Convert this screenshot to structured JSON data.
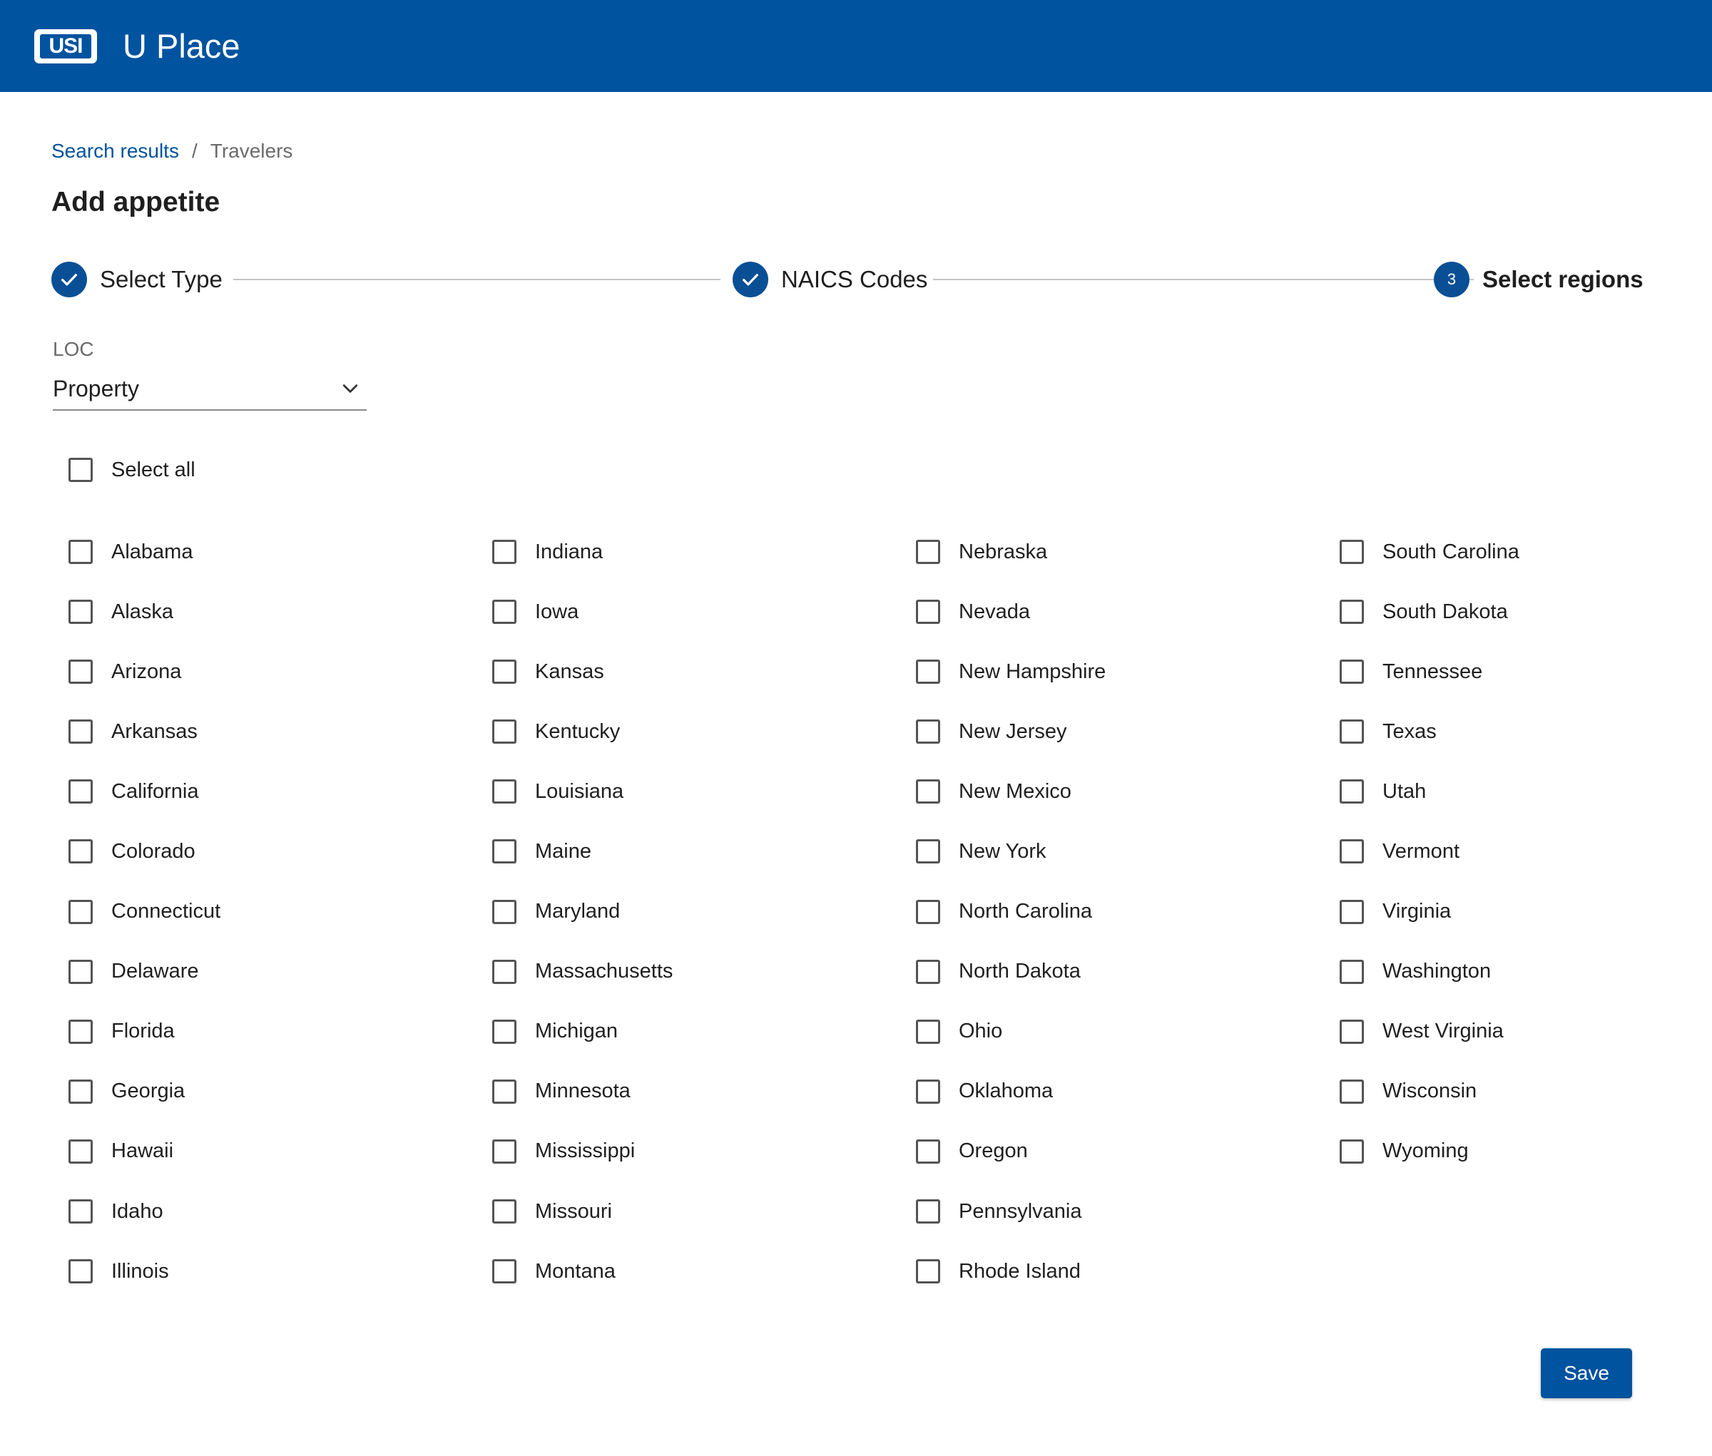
{
  "header": {
    "logo_text": "USI",
    "app_title": "U Place",
    "brand_color": "#00539f"
  },
  "breadcrumb": {
    "link": "Search results",
    "separator": "/",
    "current": "Travelers"
  },
  "page_title": "Add appetite",
  "stepper": {
    "steps": [
      {
        "label": "Select Type",
        "status": "complete",
        "icon": "check-icon"
      },
      {
        "label": "NAICS Codes",
        "status": "complete",
        "icon": "check-icon"
      },
      {
        "label": "Select regions",
        "status": "active",
        "number": "3"
      }
    ]
  },
  "loc": {
    "label": "LOC",
    "value": "Property",
    "icon": "chevron-down-icon"
  },
  "select_all": {
    "label": "Select all",
    "checked": false
  },
  "states": [
    "Alabama",
    "Alaska",
    "Arizona",
    "Arkansas",
    "California",
    "Colorado",
    "Connecticut",
    "Delaware",
    "Florida",
    "Georgia",
    "Hawaii",
    "Idaho",
    "Illinois",
    "Indiana",
    "Iowa",
    "Kansas",
    "Kentucky",
    "Louisiana",
    "Maine",
    "Maryland",
    "Massachusetts",
    "Michigan",
    "Minnesota",
    "Mississippi",
    "Missouri",
    "Montana",
    "Nebraska",
    "Nevada",
    "New Hampshire",
    "New Jersey",
    "New Mexico",
    "New York",
    "North Carolina",
    "North Dakota",
    "Ohio",
    "Oklahoma",
    "Oregon",
    "Pennsylvania",
    "Rhode Island",
    "South Carolina",
    "South Dakota",
    "Tennessee",
    "Texas",
    "Utah",
    "Vermont",
    "Virginia",
    "Washington",
    "West Virginia",
    "Wisconsin",
    "Wyoming"
  ],
  "save_label": "Save"
}
